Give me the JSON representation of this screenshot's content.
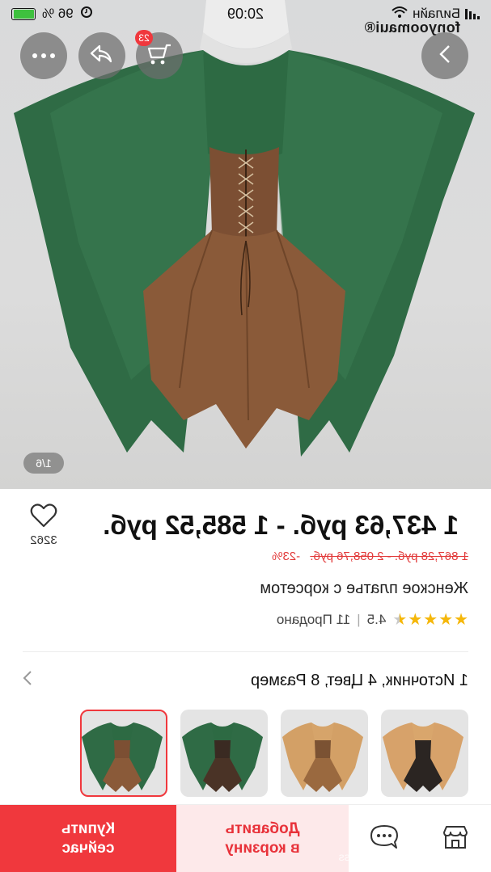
{
  "status_bar": {
    "time": "20:09",
    "carrier": "Билайн",
    "battery_percent": "96 %",
    "battery_level": 0.96
  },
  "header": {
    "brand": "fonyoomaui®",
    "cart_badge": "23",
    "icons": [
      "more-icon",
      "share-icon",
      "cart-icon",
      "next-icon"
    ]
  },
  "gallery": {
    "counter": "1/6"
  },
  "product": {
    "price": "1 437,63 руб. - 1 585,52 руб.",
    "old_price": "1 867,28 руб. - 2 058,76 руб.",
    "discount": "-23%",
    "title": "Женское платье с корсетом",
    "rating": "4.5",
    "rating_value": 4.5,
    "sold": "11 Продано",
    "favorites_count": "3262",
    "variants_summary": "1 Источник, 4 Цвет, 8 Размер"
  },
  "actions": {
    "store_icon": "store-icon",
    "chat_icon": "chat-icon",
    "add_to_cart_line1": "Добавить",
    "add_to_cart_line2": "в корзину",
    "buy_now_line1": "Купить",
    "buy_now_line2": "сейчас"
  },
  "watermark": "OnlyFans.com/dami_princess",
  "colors": {
    "accent": "#f0383d",
    "accent_light": "#fde9ea",
    "star": "#f5b70a"
  }
}
